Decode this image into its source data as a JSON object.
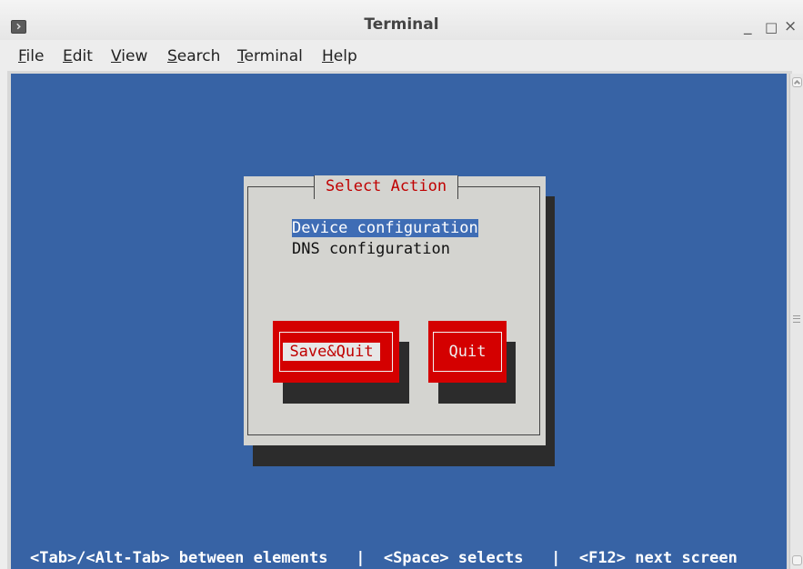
{
  "window": {
    "title": "Terminal",
    "minimize_glyph": "_",
    "maximize_glyph": "□",
    "close_glyph": "×",
    "icon": "terminal-icon"
  },
  "menubar": {
    "items": [
      "File",
      "Edit",
      "View",
      "Search",
      "Terminal",
      "Help"
    ]
  },
  "dialog": {
    "title": "Select Action",
    "options": [
      "Device configuration",
      "DNS configuration"
    ],
    "selected_option": "Device configuration",
    "buttons": {
      "save_quit": "Save&Quit",
      "quit": "Quit"
    },
    "focused_button": "Save&Quit"
  },
  "status": {
    "text": "<Tab>/<Alt-Tab> between elements   |  <Space> selects   |  <F12> next screen"
  },
  "colors": {
    "terminal_bg": "#3763a5",
    "dialog_bg": "#d4d4d0",
    "dialog_title": "#c00000",
    "button_bg": "#d40000",
    "selection_bg": "#3f6db5"
  }
}
